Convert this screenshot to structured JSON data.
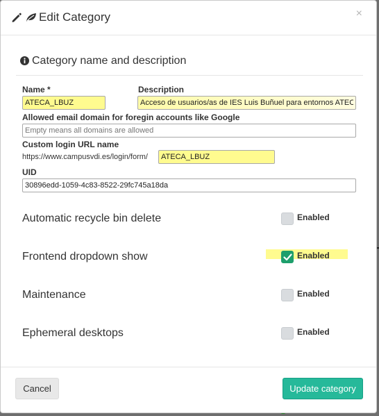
{
  "modal": {
    "title": "Edit Category",
    "close_symbol": "×",
    "icons": [
      "pencil-icon",
      "leaf-icon"
    ]
  },
  "section": {
    "icon": "info-icon",
    "title": "Category name and description"
  },
  "form": {
    "name_label": "Name *",
    "name_value": "ATECA_LBUZ",
    "description_label": "Description",
    "description_value": "Acceso de usuarios/as de IES Luis Buñuel para entornos ATECA",
    "email_domain_label": "Allowed email domain for foregin accounts like Google",
    "email_domain_placeholder": "Empty means all domains are allowed",
    "custom_url_label": "Custom login URL name",
    "custom_url_prefix": "https://www.campusvdi.es/login/form/",
    "custom_url_value": "ATECA_LBUZ",
    "uid_label": "UID",
    "uid_value": "30896edd-1059-4c83-8522-29fc745a18da"
  },
  "options": [
    {
      "label": "Automatic recycle bin delete",
      "checkbox_label": "Enabled",
      "checked": false
    },
    {
      "label": "Frontend dropdown show",
      "checkbox_label": "Enabled",
      "checked": true
    },
    {
      "label": "Maintenance",
      "checkbox_label": "Enabled",
      "checked": false
    },
    {
      "label": "Ephemeral desktops",
      "checkbox_label": "Enabled",
      "checked": false
    }
  ],
  "footer": {
    "cancel_label": "Cancel",
    "submit_label": "Update category"
  },
  "colors": {
    "primary_button": "#26b99a",
    "checkbox_checked": "#1e9f6c",
    "highlight": "#fffb8f"
  }
}
